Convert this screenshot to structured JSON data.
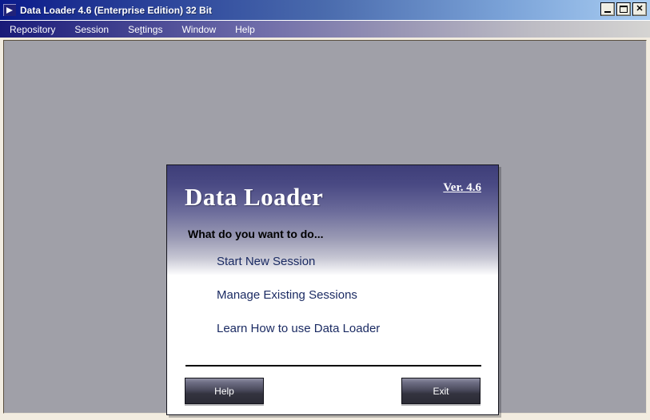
{
  "window": {
    "title": "Data Loader 4.6 (Enterprise Edition) 32 Bit",
    "icon": "app-arrow-icon",
    "controls": {
      "minimize": "_",
      "maximize": "□",
      "close": "✕"
    }
  },
  "menu": {
    "items": [
      {
        "label": "Repository",
        "accel_index": -1
      },
      {
        "label": "Session",
        "accel_index": -1
      },
      {
        "label": "Se",
        "accel": "t",
        "rest": "tings"
      },
      {
        "label": "Window",
        "accel_index": -1
      },
      {
        "label": "Help",
        "accel_index": -1
      }
    ],
    "repository": "Repository",
    "session": "Session",
    "settings_pre": "Se",
    "settings_accel": "t",
    "settings_post": "tings",
    "window": "Window",
    "help": "Help"
  },
  "dialog": {
    "brand_title": "Data Loader",
    "version": "Ver. 4.6",
    "prompt": "What do you want to do...",
    "actions": [
      {
        "label": "Start New Session"
      },
      {
        "label": "Manage Existing Sessions"
      },
      {
        "label": "Learn How to use Data Loader"
      }
    ],
    "buttons": {
      "help": "Help",
      "exit": "Exit"
    }
  },
  "colors": {
    "titlebar_start": "#0a1a8c",
    "titlebar_end": "#a9cdf2",
    "menubar_start": "#191a78",
    "menubar_end": "#d5d4d2",
    "client_background": "#a0a0a8",
    "dialog_gradient_start": "#3e3e79",
    "dialog_gradient_end": "#ffffff",
    "link_color": "#1b2b63",
    "button_text": "#ffffff"
  }
}
